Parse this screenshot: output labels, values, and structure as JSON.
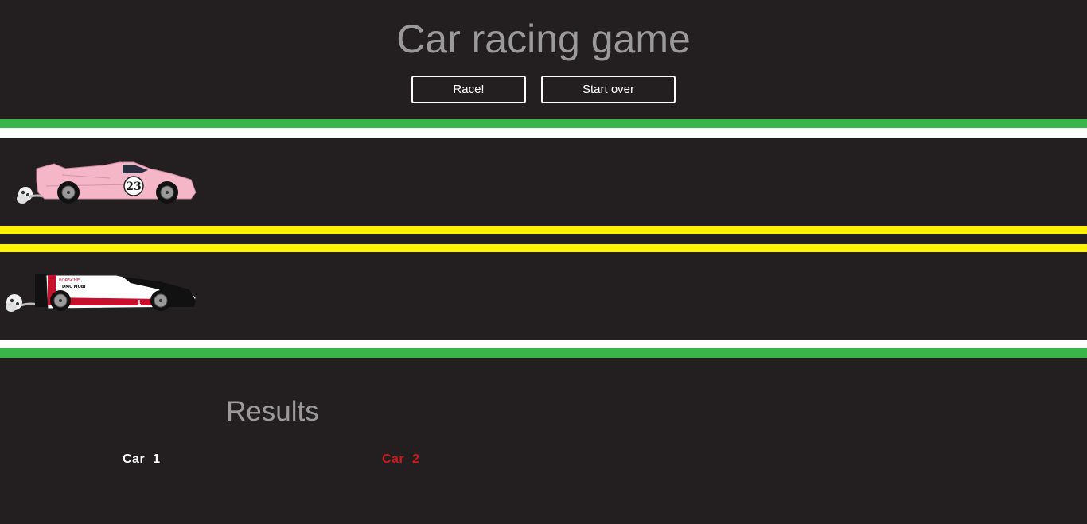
{
  "header": {
    "title": "Car racing game"
  },
  "controls": {
    "race_label": "Race!",
    "reset_label": "Start over"
  },
  "track": {
    "colors": {
      "grass": "#3ab54a",
      "edge": "#ffffff",
      "divider": "#fff200",
      "asphalt": "#231f20"
    },
    "cars": [
      {
        "name": "pink-porsche-917",
        "number": "23",
        "color": "#f5b7c8"
      },
      {
        "name": "porsche-919-hybrid",
        "number": "1",
        "color": "#ffffff",
        "livery_text": "PORSCHE",
        "sponsor_text": "DMC MOBI"
      }
    ]
  },
  "results": {
    "title": "Results",
    "entries": [
      {
        "label": "Car  1",
        "color": "#ffffff"
      },
      {
        "label": "Car  2",
        "color": "#cc1a1a"
      }
    ]
  }
}
